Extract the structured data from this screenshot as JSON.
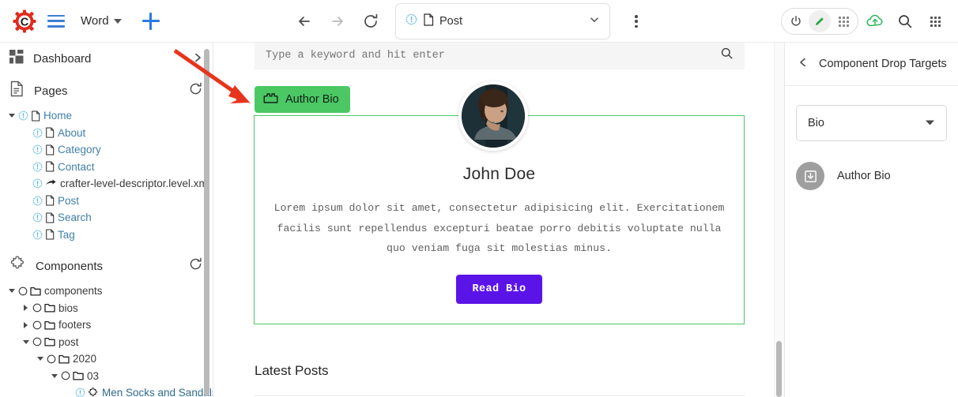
{
  "topbar": {
    "logo_icon": "crafter-gear-logo",
    "menu_icon": "hamburger-menu-icon",
    "project_label": "Word",
    "project_caret_icon": "chevron-down-icon",
    "add_icon": "plus-icon",
    "back_icon": "arrow-left-icon",
    "forward_icon": "arrow-right-icon",
    "reload_icon": "reload-icon",
    "url_item_icon": "page-state-icon",
    "url_doc_icon": "document-icon",
    "url_text": "Post",
    "url_caret_icon": "chevron-down-icon",
    "kebab_icon": "more-vertical-icon",
    "power_icon": "power-icon",
    "edit_icon": "pencil-icon",
    "grid_icon": "grid-dots-icon",
    "publish_icon": "cloud-upload-icon",
    "search_icon": "search-icon",
    "apps_icon": "apps-grid-icon"
  },
  "sidebar": {
    "dashboard": {
      "label": "Dashboard",
      "icon": "dashboard-icon",
      "chevron": "chevron-right-icon"
    },
    "pages": {
      "title": "Pages",
      "icon": "pages-document-icon",
      "refresh_icon": "refresh-icon",
      "items": [
        {
          "label": "Home",
          "depth": 0,
          "arrow": "down",
          "state_icon": "page-state-icon",
          "type_icon": "document-icon",
          "style": "blue"
        },
        {
          "label": "About",
          "depth": 1,
          "arrow": "none",
          "state_icon": "page-state-icon",
          "type_icon": "document-icon",
          "style": "blue"
        },
        {
          "label": "Category",
          "depth": 1,
          "arrow": "none",
          "state_icon": "page-state-icon",
          "type_icon": "document-icon",
          "style": "blue"
        },
        {
          "label": "Contact",
          "depth": 1,
          "arrow": "none",
          "state_icon": "page-state-icon",
          "type_icon": "document-icon",
          "style": "blue"
        },
        {
          "label": "crafter-level-descriptor.level.xml",
          "depth": 1,
          "arrow": "none",
          "state_icon": "page-state-icon",
          "type_icon": "level-descriptor-icon",
          "style": "dark"
        },
        {
          "label": "Post",
          "depth": 1,
          "arrow": "none",
          "state_icon": "page-state-icon",
          "type_icon": "document-icon",
          "style": "blue"
        },
        {
          "label": "Search",
          "depth": 1,
          "arrow": "none",
          "state_icon": "page-state-icon",
          "type_icon": "document-icon",
          "style": "blue"
        },
        {
          "label": "Tag",
          "depth": 1,
          "arrow": "none",
          "state_icon": "page-state-icon",
          "type_icon": "document-icon",
          "style": "blue"
        }
      ]
    },
    "components": {
      "title": "Components",
      "icon": "puzzle-piece-icon",
      "refresh_icon": "refresh-icon",
      "items": [
        {
          "label": "components",
          "depth": 0,
          "arrow": "down",
          "select_icon": "radio-circle-icon",
          "type_icon": "folder-icon",
          "style": "dark"
        },
        {
          "label": "bios",
          "depth": 1,
          "arrow": "right",
          "select_icon": "radio-circle-icon",
          "type_icon": "folder-icon",
          "style": "dark"
        },
        {
          "label": "footers",
          "depth": 1,
          "arrow": "right",
          "select_icon": "radio-circle-icon",
          "type_icon": "folder-icon",
          "style": "dark"
        },
        {
          "label": "post",
          "depth": 1,
          "arrow": "down",
          "select_icon": "radio-circle-icon",
          "type_icon": "folder-icon",
          "style": "dark"
        },
        {
          "label": "2020",
          "depth": 2,
          "arrow": "down",
          "select_icon": "radio-circle-icon",
          "type_icon": "folder-icon",
          "style": "dark"
        },
        {
          "label": "03",
          "depth": 3,
          "arrow": "down",
          "select_icon": "radio-circle-icon",
          "type_icon": "folder-icon",
          "style": "dark"
        },
        {
          "label": "Men Socks and Sandals",
          "depth": 4,
          "arrow": "none",
          "select_icon": "page-state-icon",
          "type_icon": "puzzle-piece-icon",
          "style": "link"
        }
      ]
    },
    "scrollbar": "sidebar-scrollbar"
  },
  "content": {
    "search_placeholder": "Type a keyword and hit enter",
    "search_icon": "search-icon",
    "drop_badge": {
      "label": "Author Bio",
      "icon": "drop-zone-icon"
    },
    "bio": {
      "avatar": "author-avatar-photo",
      "name": "John Doe",
      "text": "Lorem ipsum dolor sit amet, consectetur adipisicing elit. Exercitationem facilis sunt repellendus excepturi beatae porro debitis voluptate nulla quo veniam fuga sit molestias minus.",
      "button_label": "Read Bio"
    },
    "latest_posts_title": "Latest Posts",
    "scrollbar": "content-scrollbar"
  },
  "right_panel": {
    "back_icon": "chevron-left-icon",
    "title": "Component Drop Targets",
    "select_value": "Bio",
    "select_caret_icon": "chevron-down-icon",
    "item": {
      "label": "Author Bio",
      "icon": "drop-target-avatar-icon"
    }
  },
  "annotation": {
    "arrow": "red-pointer-arrow"
  },
  "colors": {
    "accent_green": "#4bc864",
    "button_purple": "#5b14e8",
    "annotation_red": "#e8341c",
    "brand_red": "#e02a1c",
    "link_blue": "#2a7ae2"
  }
}
